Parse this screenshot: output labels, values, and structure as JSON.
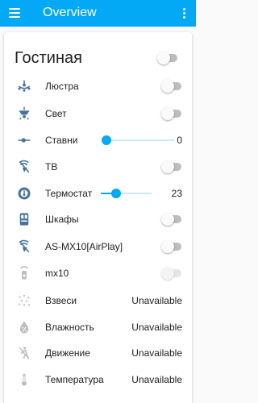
{
  "header": {
    "title": "Overview",
    "menu_icon": "menu-icon",
    "more_icon": "more-vert-icon"
  },
  "colors": {
    "accent": "#03a9f4",
    "icon": "#44739e",
    "icon_disabled": "#bdbdbd"
  },
  "card": {
    "title": "Гостиная",
    "toggle_on": false,
    "entities": [
      {
        "icon": "chandelier-icon",
        "label": "Люстра",
        "control": "toggle",
        "state": "off"
      },
      {
        "icon": "ceiling-light-icon",
        "label": "Свет",
        "control": "toggle",
        "state": "off"
      },
      {
        "icon": "blinds-slider-icon",
        "label": "Ставни",
        "control": "slider",
        "slider_fraction": 0,
        "value": "0"
      },
      {
        "icon": "tv-off-icon",
        "label": "ТВ",
        "control": "toggle",
        "state": "off"
      },
      {
        "icon": "thermostat-icon",
        "label": "Термостат",
        "control": "slider",
        "slider_fraction": 0.3,
        "value": "23"
      },
      {
        "icon": "cabinet-icon",
        "label": "Шкафы",
        "control": "toggle",
        "state": "off"
      },
      {
        "icon": "cast-off-icon",
        "label": "AS-MX10[AirPlay]",
        "control": "toggle",
        "state": "off"
      },
      {
        "icon": "speaker-icon",
        "label": "mx10",
        "control": "toggle",
        "state": "disabled"
      },
      {
        "icon": "dust-icon",
        "label": "Взвеси",
        "control": "text",
        "value": "Unavailable"
      },
      {
        "icon": "humidity-icon",
        "label": "Влажность",
        "control": "text",
        "value": "Unavailable"
      },
      {
        "icon": "motion-icon",
        "label": "Движение",
        "control": "text",
        "value": "Unavailable"
      },
      {
        "icon": "thermometer-icon",
        "label": "Температура",
        "control": "text",
        "value": "Unavailable"
      }
    ]
  }
}
